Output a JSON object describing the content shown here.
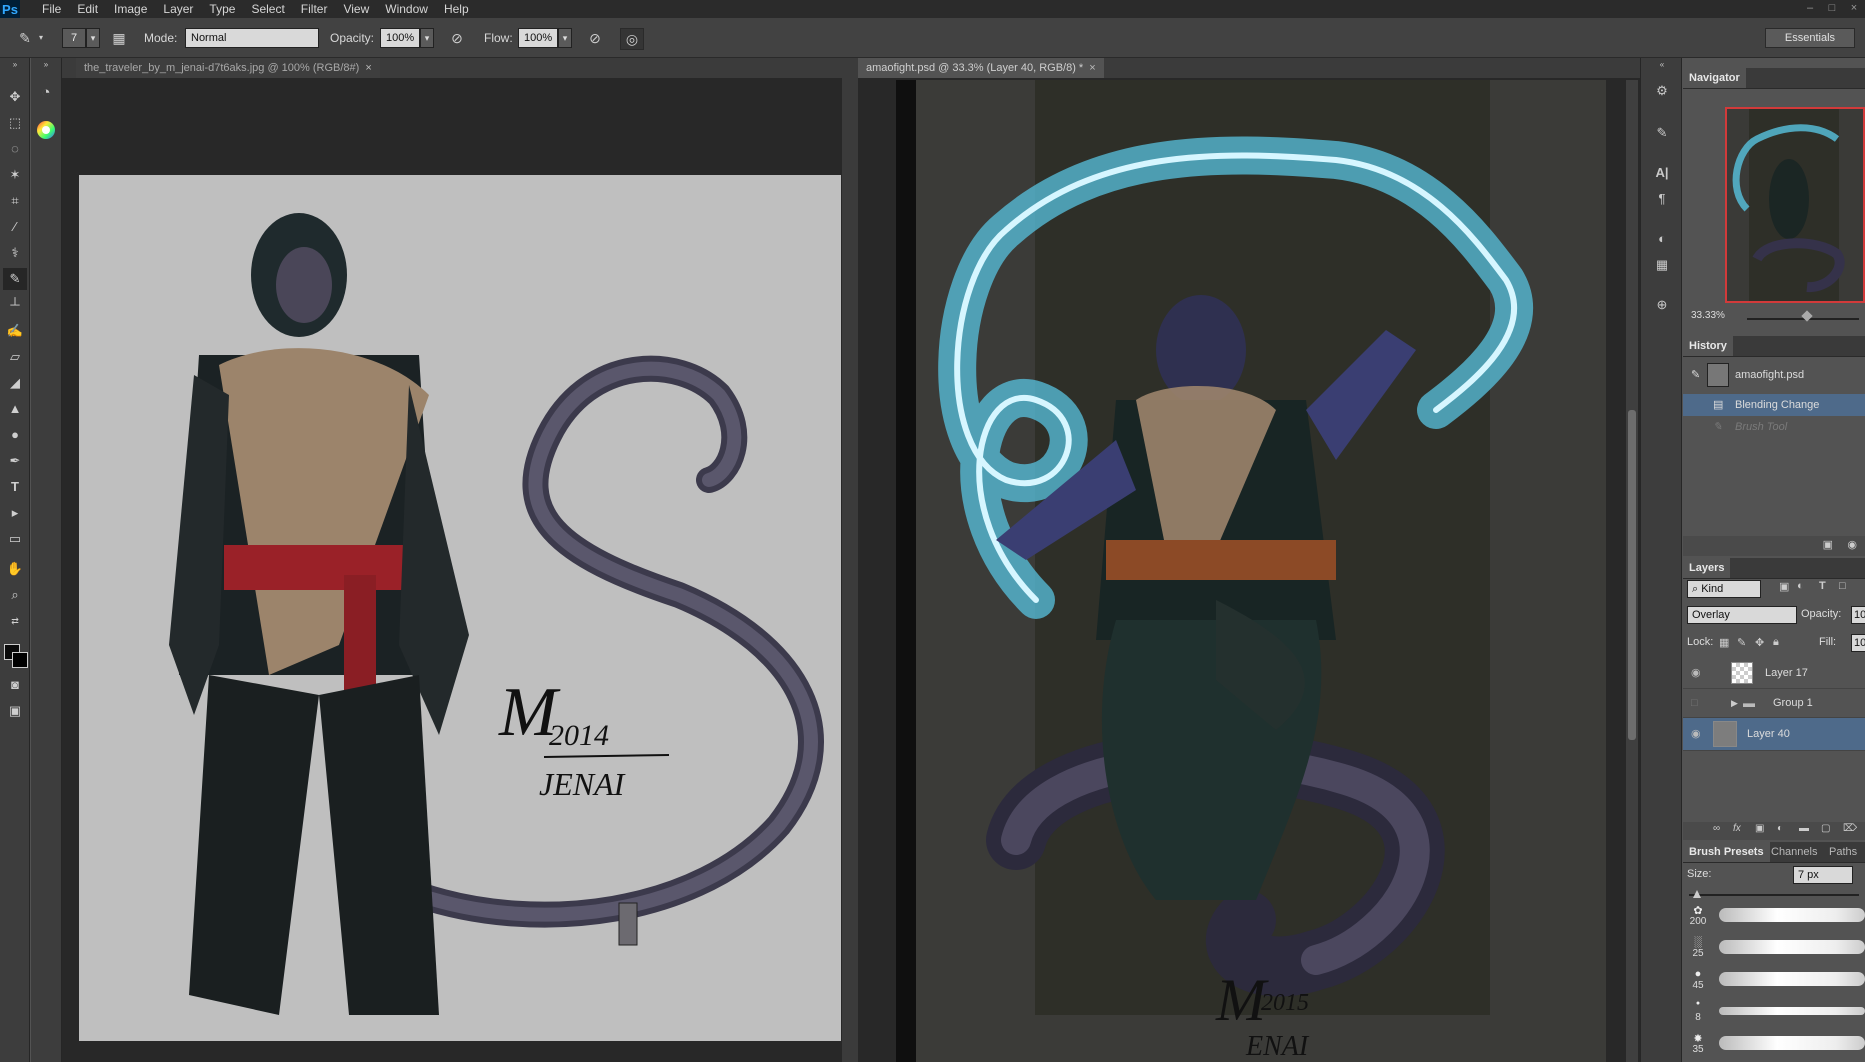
{
  "app": {
    "logo": "Ps"
  },
  "menu": [
    "File",
    "Edit",
    "Image",
    "Layer",
    "Type",
    "Select",
    "Filter",
    "View",
    "Window",
    "Help"
  ],
  "window_controls": [
    "–",
    "□",
    "×"
  ],
  "options_bar": {
    "brush_size": "7",
    "mode_label": "Mode:",
    "mode_value": "Normal",
    "opacity_label": "Opacity:",
    "opacity_value": "100%",
    "flow_label": "Flow:",
    "flow_value": "100%",
    "workspace": "Essentials"
  },
  "documents": [
    {
      "tab": "the_traveler_by_m_jenai-d7t6aks.jpg @ 100% (RGB/8#)",
      "active": false,
      "close": "×"
    },
    {
      "tab": "amaofight.psd @ 33.3% (Layer 40, RGB/8) *",
      "active": true,
      "close": "×"
    }
  ],
  "canvas1": {
    "signature_name": "JENAI",
    "signature_year": "2014",
    "signature_initial": "M"
  },
  "canvas2": {
    "signature_name": "ENAI",
    "signature_year": "2015",
    "signature_initial": "M"
  },
  "navigator": {
    "title": "Navigator",
    "zoom": "33.33%"
  },
  "history": {
    "title": "History",
    "snapshot": "amaofight.psd",
    "items": [
      {
        "label": "Blending Change",
        "state": "selected"
      },
      {
        "label": "Brush Tool",
        "state": "undone"
      }
    ]
  },
  "layers": {
    "title": "Layers",
    "kind_label": "Kind",
    "blend_mode": "Overlay",
    "opacity_label": "Opacity:",
    "opacity_value": "10",
    "lock_label": "Lock:",
    "fill_label": "Fill:",
    "fill_value": "10",
    "items": [
      {
        "name": "Layer 17",
        "visible": true,
        "selected": false,
        "type": "layer"
      },
      {
        "name": "Group 1",
        "visible": false,
        "selected": false,
        "type": "group"
      },
      {
        "name": "Layer 40",
        "visible": true,
        "selected": true,
        "type": "layer"
      }
    ]
  },
  "brush_presets": {
    "tabs": [
      "Brush Presets",
      "Channels",
      "Paths"
    ],
    "size_label": "Size:",
    "size_value": "7 px",
    "brushes": [
      "200",
      "25",
      "45",
      "8",
      "35",
      ""
    ]
  }
}
